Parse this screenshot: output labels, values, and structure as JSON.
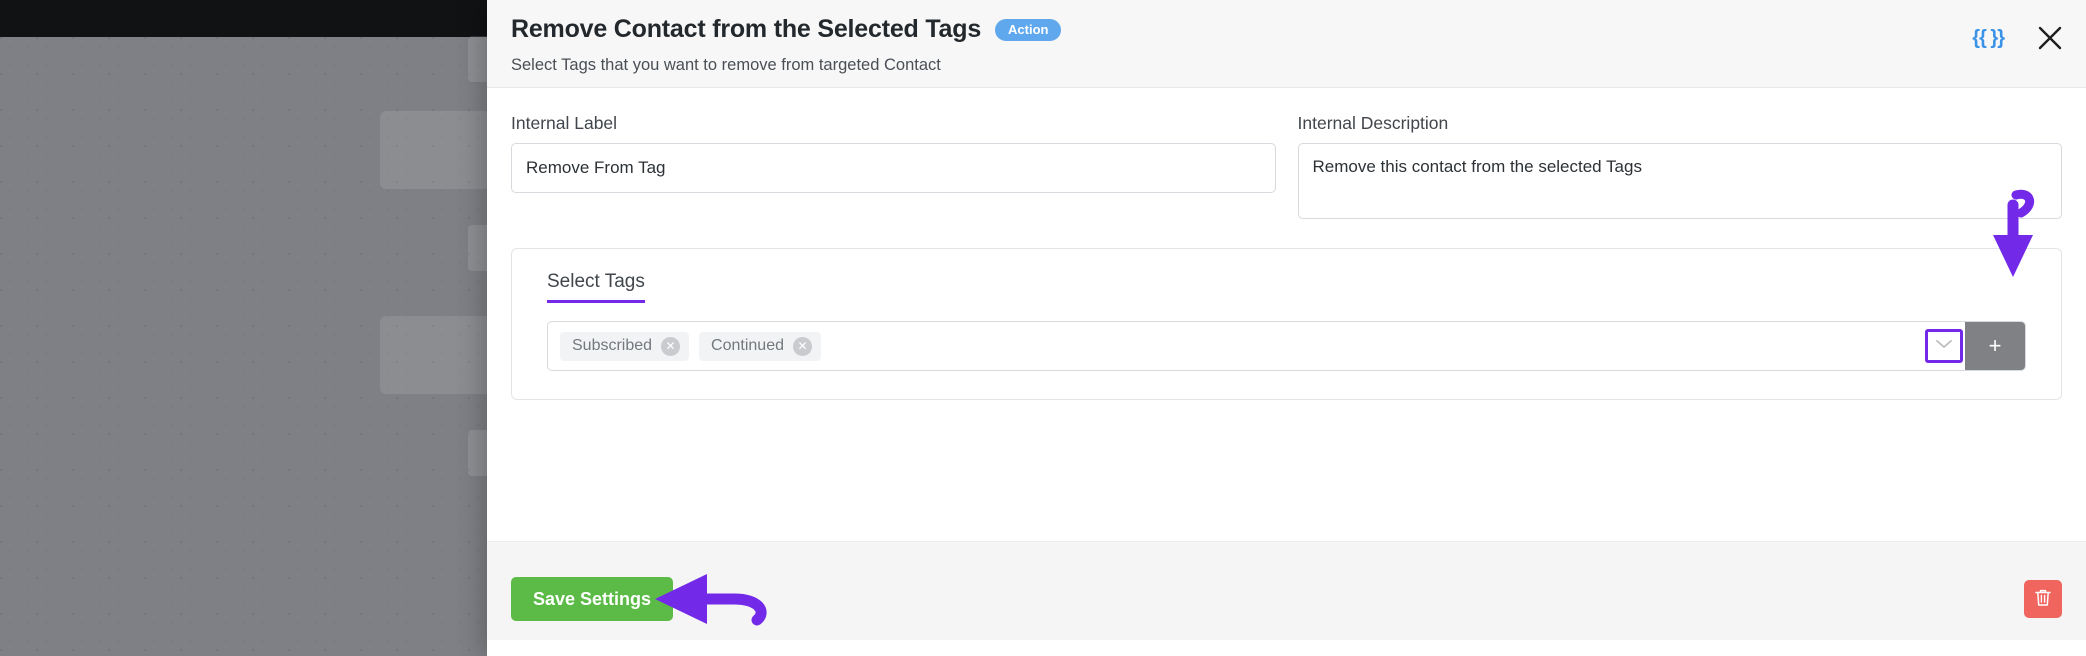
{
  "modal": {
    "title": "Remove Contact from the Selected Tags",
    "badge": "Action",
    "subtitle": "Select Tags that you want to remove from targeted Contact",
    "merge_icon_label": "{{ }}",
    "close_icon_label": "✕"
  },
  "form": {
    "internal_label": {
      "label": "Internal Label",
      "value": "Remove From Tag",
      "placeholder": "Internal Label"
    },
    "internal_description": {
      "label": "Internal Description",
      "value": "Remove this contact from the selected Tags",
      "placeholder": "Internal Description"
    }
  },
  "tags_section": {
    "heading": "Select Tags",
    "chips": [
      {
        "label": "Subscribed",
        "remove_icon": "✕"
      },
      {
        "label": "Continued",
        "remove_icon": "✕"
      }
    ],
    "dropdown_icon": "chevron-down-icon",
    "add_button_label": "+"
  },
  "footer": {
    "save_label": "Save Settings",
    "delete_icon": "trash-icon"
  },
  "annotations": {
    "arrow_to_add_button": "purple-curved-arrow-down",
    "arrow_to_save_button": "purple-curved-arrow-left"
  },
  "colors": {
    "accent_purple": "#7229e8",
    "badge_blue": "#5fa8ee",
    "save_green": "#5cbb46",
    "delete_red": "#f0655e",
    "merge_icon_blue": "#3b93e8",
    "overlay_gray": "#7e8085"
  }
}
